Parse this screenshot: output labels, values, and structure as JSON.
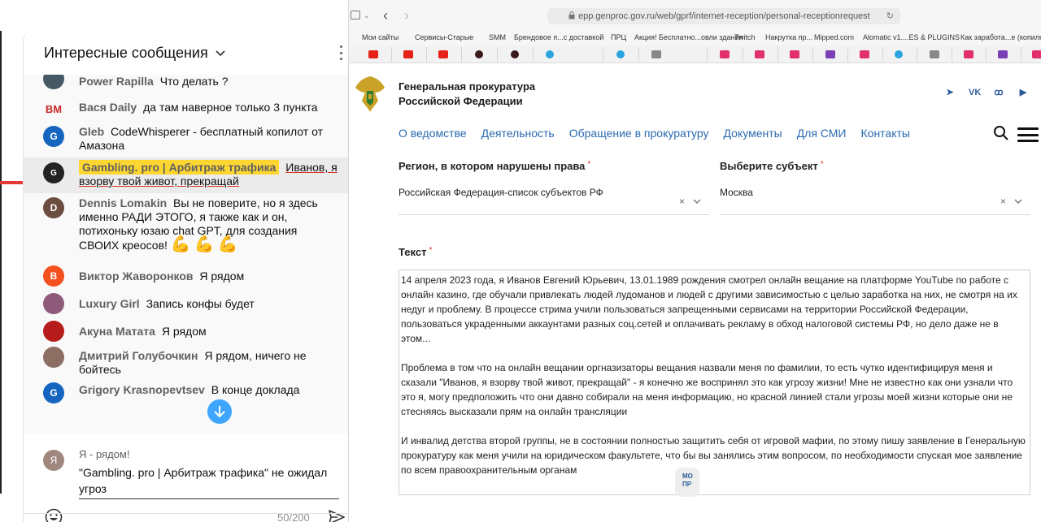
{
  "chat": {
    "title": "Интересные сообщения",
    "messages": [
      {
        "author": "Power Rapilla",
        "text": "Что делать ?",
        "avatar_letter": "",
        "avatar_color": "#455a64"
      },
      {
        "author": "Вася Daily",
        "text": "да там наверное только 3 пункта",
        "avatar_letter": "BM",
        "avatar_color": "#c62828"
      },
      {
        "author": "Gleb",
        "text": "CodeWhisperer - бесплатный копилот от Амазона",
        "avatar_letter": "G",
        "avatar_color": "#1565c0"
      },
      {
        "author": "Gambling. pro | Арбитраж трафика",
        "text": "Иванов, я взорву твой живот, прекращай",
        "avatar_letter": "G",
        "avatar_color": "#222222"
      },
      {
        "author": "Dennis Lomakin",
        "text": "Вы не поверите, но я здесь именно РАДИ ЭТОГО, я также как и он, потихоньку юзаю chat GPT, для создания СВОИХ креосов!",
        "avatar_letter": "D",
        "avatar_color": "#6d4c41"
      },
      {
        "author": "Виктор Жаворонков",
        "text": "Я рядом",
        "avatar_letter": "В",
        "avatar_color": "#f4511e"
      },
      {
        "author": "Luxury Girl",
        "text": "Запись конфы будет",
        "avatar_letter": "",
        "avatar_color": "#8e5a7a"
      },
      {
        "author": "Акуна Матата",
        "text": "Я рядом",
        "avatar_letter": "",
        "avatar_color": "#b71c1c"
      },
      {
        "author": "Дмитрий Голубочкин",
        "text": "Я рядом, ничего не бойтесь",
        "avatar_letter": "",
        "avatar_color": "#8d6e63"
      },
      {
        "author": "Grigory Krasnopevtsev",
        "text": "В конце доклада",
        "avatar_letter": "G",
        "avatar_color": "#1565c0"
      }
    ],
    "emoji_arms": "💪💪💪",
    "compose": {
      "avatar_letter": "Я",
      "name": "Я - рядом!",
      "text": "\"Gambling. pro | Арбитраж трафика\" не ожидал угроз",
      "counter": "50/200"
    }
  },
  "browser": {
    "url": "epp.genproc.gov.ru/web/gprf/internet-reception/personal-receptionrequest",
    "bookmarks": [
      "Мои сайты",
      "Сервисы-Старые",
      "SMM",
      "Брендовое п...с доставкой",
      "ПРЦ",
      "Акция! Бесплатно...овли здания",
      "Twitch",
      "Накрутка пр...",
      "Mipped.com",
      "Alomatic v1....ES & PLUGINS",
      "Как заработа...е (копилка)"
    ],
    "site": {
      "org_line1": "Генеральная прокуратура",
      "org_line2": "Российской Федерации",
      "nav": [
        "О ведомстве",
        "Деятельность",
        "Обращение в прокуратуру",
        "Документы",
        "Для СМИ",
        "Контакты"
      ],
      "social_vk": "VK"
    },
    "form": {
      "region_label": "Регион, в котором нарушены права",
      "region_value": "Российская Федерация-список субъектов РФ",
      "subject_label": "Выберите субъект",
      "subject_value": "Москва",
      "text_label": "Текст",
      "required_mark": "*",
      "clear_icon": "×",
      "para1": "14 апреля 2023 года, я Иванов Евгений Юрьевич, 13.01.1989 рождения смотрел онлайн вещание на платформе YouTube по работе с онлайн казино, где обучали привлекать людей лудоманов и людей с другими зависимостью с целью заработка на них, не смотря на их недуг и проблему. В процессе стрима учили пользоваться запрещенными сервисами на территории Российской Федерации, пользоваться украденными аккаунтами разных соц.сетей и оплачивать рекламу в обход налоговой системы РФ, но дело даже не в этом...",
      "para2": "Проблема в том что на онлайн вещании оргназизаторы вещания назвали меня по фамилии, то есть чутко идентифицируя меня и сказали \"Иванов, я взорву твой живот, прекращай\" - я конечно же воспринял это как угрозу жизни! Мне не известно как они узнали что это я, могу предположить что они давно собирали на меня информацию, но красной линией стали угрозы моей жизни которые они не стесняясь высказали прям на онлайн трансляции",
      "para3": "И инвалид детства второй группы, не в состоянии полностью защитить себя от игровой мафии, по этому пишу заявление в Генеральную прокуратуру как меня учили на юридическом факультете, что бы вы занялись этим вопросом, по необходимости спуская мое заявление по всем правоохранительным органам"
    },
    "helper_text": "МО ПР"
  }
}
